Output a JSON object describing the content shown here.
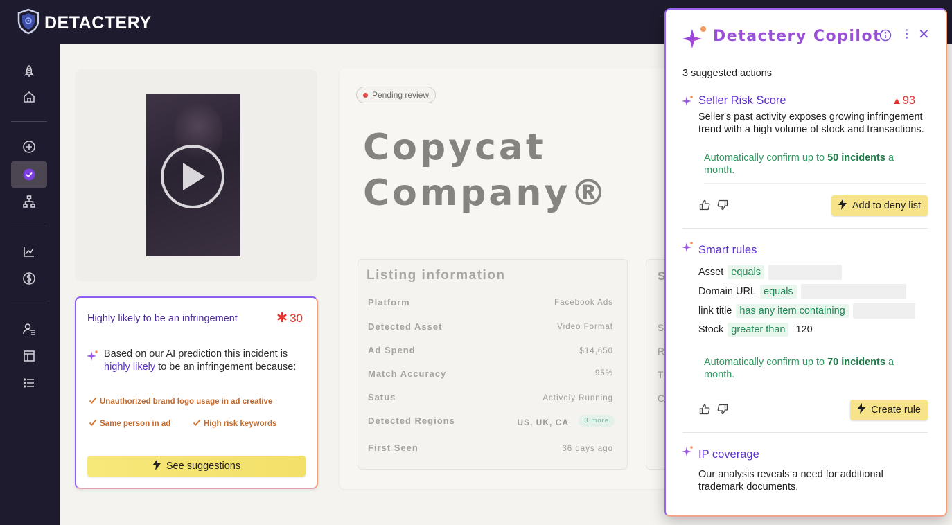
{
  "app": {
    "name": "DETACTERY"
  },
  "sidebar": {
    "items": [
      {
        "name": "rocket-icon"
      },
      {
        "name": "home-icon"
      },
      {
        "name": "add-circle-icon"
      },
      {
        "name": "check-circle-icon",
        "active": true
      },
      {
        "name": "hierarchy-icon"
      },
      {
        "name": "chart-icon"
      },
      {
        "name": "dollar-icon"
      },
      {
        "name": "users-icon"
      },
      {
        "name": "layout-icon"
      },
      {
        "name": "list-icon"
      }
    ]
  },
  "infringement_card": {
    "title": "Highly likely to be an infringement",
    "score": "30",
    "text_prefix": "Based on our AI prediction this incident is ",
    "text_highlight": "highly likely",
    "text_suffix": " to be an infringement because:",
    "reasons": [
      "Unauthorized brand logo usage in ad creative",
      "Same person in ad",
      "High risk keywords"
    ],
    "button_label": "See suggestions"
  },
  "details": {
    "status": "Pending review",
    "company_line1": "Copycat",
    "company_line2": "Company®",
    "listing_title": "Listing information",
    "rows": [
      {
        "label": "Platform",
        "value": "Facebook Ads"
      },
      {
        "label": "Detected Asset",
        "value": "Video Format"
      },
      {
        "label": "Ad Spend",
        "value": "$14,650"
      },
      {
        "label": "Match Accuracy",
        "value": "95%"
      },
      {
        "label": "Satus",
        "value": "Actively Running"
      },
      {
        "label": "Detected Regions",
        "value": "US, UK, CA",
        "chip": "3 more"
      },
      {
        "label": "First Seen",
        "value": "36 days ago"
      }
    ],
    "side_letters": [
      "S",
      "S",
      "R",
      "T",
      "C"
    ]
  },
  "copilot": {
    "title": "Detactery Copilot",
    "count_label": "3 suggested actions",
    "sections": {
      "risk": {
        "title": "Seller Risk Score",
        "score": "93",
        "text": "Seller's past activity exposes growing infringement trend with a high volume of stock and transactions.",
        "auto_prefix": "Automatically confirm up to ",
        "auto_bold": "50 incidents",
        "auto_suffix": " a month.",
        "button_label": "Add to deny list"
      },
      "rules": {
        "title": "Smart rules",
        "rows": [
          {
            "field": "Asset",
            "op": "equals"
          },
          {
            "field": "Domain URL",
            "op": "equals"
          },
          {
            "field": "link title",
            "op": "has any item containing"
          },
          {
            "field": "Stock",
            "op": "greater than",
            "value": "120"
          }
        ],
        "auto_prefix": "Automatically confirm up to ",
        "auto_bold": "70 incidents",
        "auto_suffix": " a month.",
        "button_label": "Create rule"
      },
      "ip": {
        "title": "IP coverage",
        "text": "Our analysis reveals a need for additional trademark documents."
      }
    }
  },
  "colors": {
    "accent_purple": "#5b2fc9",
    "danger_red": "#e5322d",
    "success_green": "#2e9a60",
    "button_yellow": "#f7e48a"
  }
}
